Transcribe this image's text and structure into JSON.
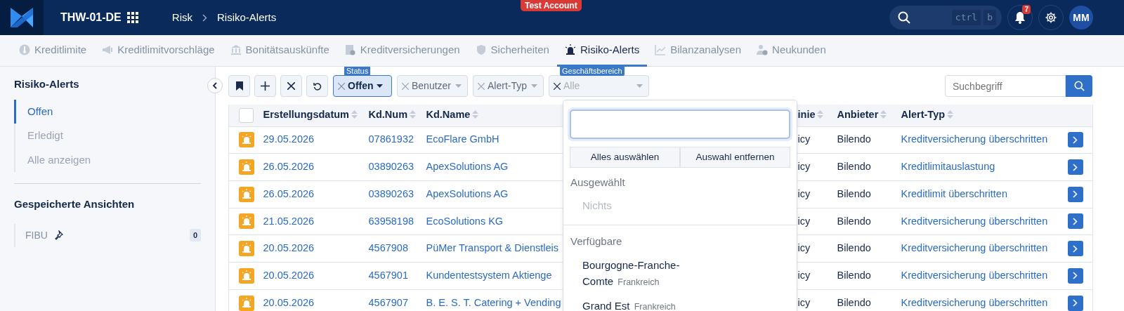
{
  "header": {
    "app_title": "THW-01-DE",
    "breadcrumb": [
      "Risk",
      "Risiko-Alerts"
    ],
    "environment_badge": "Test Account",
    "search": {
      "shortcut": [
        "ctrl",
        "b"
      ]
    },
    "notifications_count": "7",
    "avatar_initials": "MM"
  },
  "tabs": [
    {
      "label": "Kreditlimite",
      "selected": false
    },
    {
      "label": "Kreditlimitvorschläge",
      "selected": false
    },
    {
      "label": "Bonitätsauskünfte",
      "selected": false
    },
    {
      "label": "Kreditversicherungen",
      "selected": false
    },
    {
      "label": "Sicherheiten",
      "selected": false
    },
    {
      "label": "Risiko-Alerts",
      "selected": true
    },
    {
      "label": "Bilanzanalysen",
      "selected": false
    },
    {
      "label": "Neukunden",
      "selected": false
    }
  ],
  "sidebar": {
    "title": "Risiko-Alerts",
    "items": [
      {
        "label": "Offen",
        "selected": true
      },
      {
        "label": "Erledigt",
        "selected": false
      },
      {
        "label": "Alle anzeigen",
        "selected": false
      }
    ],
    "saved_views_title": "Gespeicherte Ansichten",
    "saved_views": [
      {
        "label": "FIBU",
        "count": "0"
      }
    ]
  },
  "filters": [
    {
      "label": "Status",
      "value": "Offen"
    },
    {
      "placeholder": "Benutzer"
    },
    {
      "placeholder": "Alert-Typ"
    },
    {
      "label": "Geschäftsbereich",
      "placeholder": "Alle"
    }
  ],
  "search": {
    "placeholder": "Suchbegriff"
  },
  "table": {
    "select_all": {
      "checked": false
    },
    "columns": [
      "Erstellungsdatum",
      "Kd.Num",
      "Kd.Name",
      "inie",
      "Anbieter",
      "Alert-Typ"
    ],
    "rows": [
      {
        "date": "29.05.2026",
        "number": "07861932",
        "name": "EcoFlare GmbH",
        "column_4": "icy",
        "provider": "Bilendo",
        "alert_type": "Kreditversicherung überschritten"
      },
      {
        "date": "26.05.2026",
        "number": "03890263",
        "name": "ApexSolutions AG",
        "column_4": "icy",
        "provider": "Bilendo",
        "alert_type": "Kreditlimitauslastung"
      },
      {
        "date": "26.05.2026",
        "number": "03890263",
        "name": "ApexSolutions AG",
        "column_4": "icy",
        "provider": "Bilendo",
        "alert_type": "Kreditlimit überschritten"
      },
      {
        "date": "21.05.2026",
        "number": "63958198",
        "name": "EcoSolutions KG",
        "column_4": "icy",
        "provider": "Bilendo",
        "alert_type": "Kreditversicherung überschritten"
      },
      {
        "date": "20.05.2026",
        "number": "4567908",
        "name": "PüMer Transport & Dienstleis",
        "column_4": "icy",
        "provider": "Bilendo",
        "alert_type": "Kreditversicherung überschritten"
      },
      {
        "date": "20.05.2026",
        "number": "4567901",
        "name": "Kundentestsystem Aktienge",
        "column_4": "icy",
        "provider": "Bilendo",
        "alert_type": "Kreditversicherung überschritten"
      },
      {
        "date": "20.05.2026",
        "number": "4567907",
        "name": "B. E. S. T. Catering + Vending",
        "column_4": "icy",
        "provider": "Bilendo",
        "alert_type": "Kreditversicherung überschritten"
      }
    ]
  },
  "dropdown": {
    "actions": [
      "Alles auswählen",
      "Auswahl entfernen"
    ],
    "selected_heading": "Ausgewählt",
    "selected_empty": "Nichts",
    "available_heading": "Verfügbare",
    "options": [
      {
        "name": "Bourgogne-Franche-Comte",
        "country": "Frankreich"
      },
      {
        "name": "Grand Est",
        "country": "Frankreich"
      }
    ]
  }
}
